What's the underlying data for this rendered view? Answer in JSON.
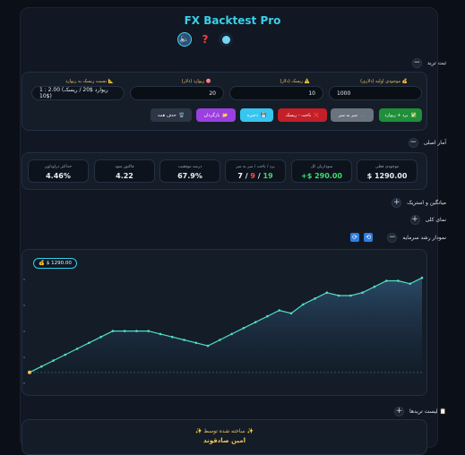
{
  "app": {
    "title": "FX Backtest Pro"
  },
  "header_icons": [
    "speaker-icon",
    "question-icon",
    "theme-icon"
  ],
  "trade_entry": {
    "section_title": "ثبت ترید",
    "fields": {
      "initial_balance_label": "موجودی اولیه (دلاری)",
      "initial_balance_value": "1000",
      "risk_label": "ریسک (دلار)",
      "risk_value": "10",
      "reward_label": "ریوارد (دلار)",
      "reward_value": "20",
      "rr_label": "نسبت ریسک به ریوارد",
      "rr_value": "1 : 2.00 (ریوارد $20 / ریسک $10)"
    },
    "buttons": {
      "win": "برد + ریوارد",
      "breakeven": "سر به سر",
      "loss": "باخت - ریسک",
      "save": "ذخیره",
      "restore": "بازگردان",
      "delete_all": "حذف همه"
    }
  },
  "stats": {
    "section_title": "آمار اصلی",
    "items": [
      {
        "label": "موجودی فعلی",
        "value": "$ 1290.00",
        "color": "#ffffff"
      },
      {
        "label": "سود/زیان کل",
        "value": "+$ 290.00",
        "color": "#3ddc6f"
      },
      {
        "label": "برد / باخت / سر به سر",
        "wins": "19",
        "losses": "9",
        "breakeven": "7"
      },
      {
        "label": "درصد موفقیت",
        "value": "67.9%",
        "color": "#ffffff"
      },
      {
        "label": "فاکتور سود",
        "value": "4.22",
        "color": "#ffffff"
      },
      {
        "label": "حداکثر دراوداون",
        "value": "4.46%",
        "color": "#ffffff"
      }
    ]
  },
  "sections": {
    "averages": "میانگین و استریک",
    "overview": "نمای کلی",
    "equity": "نمودار رشد سرمایه",
    "trade_list": "لیست تریدها"
  },
  "chart_data": {
    "type": "area",
    "badge": "$ 1290.00",
    "values": [
      1000,
      1020,
      1040,
      1060,
      1080,
      1100,
      1120,
      1140,
      1140,
      1140,
      1140,
      1130,
      1120,
      1110,
      1100,
      1090,
      1110,
      1130,
      1150,
      1170,
      1190,
      1210,
      1200,
      1230,
      1250,
      1270,
      1260,
      1260,
      1270,
      1290,
      1310,
      1310,
      1300,
      1320
    ],
    "ylim": [
      960,
      1360
    ],
    "baseline": 1000,
    "line_color": "#4fe0c4",
    "point_color": "#4fe0c4"
  },
  "footer": {
    "credit": "ساخته شده توسط",
    "author": "امین صادقوند"
  }
}
